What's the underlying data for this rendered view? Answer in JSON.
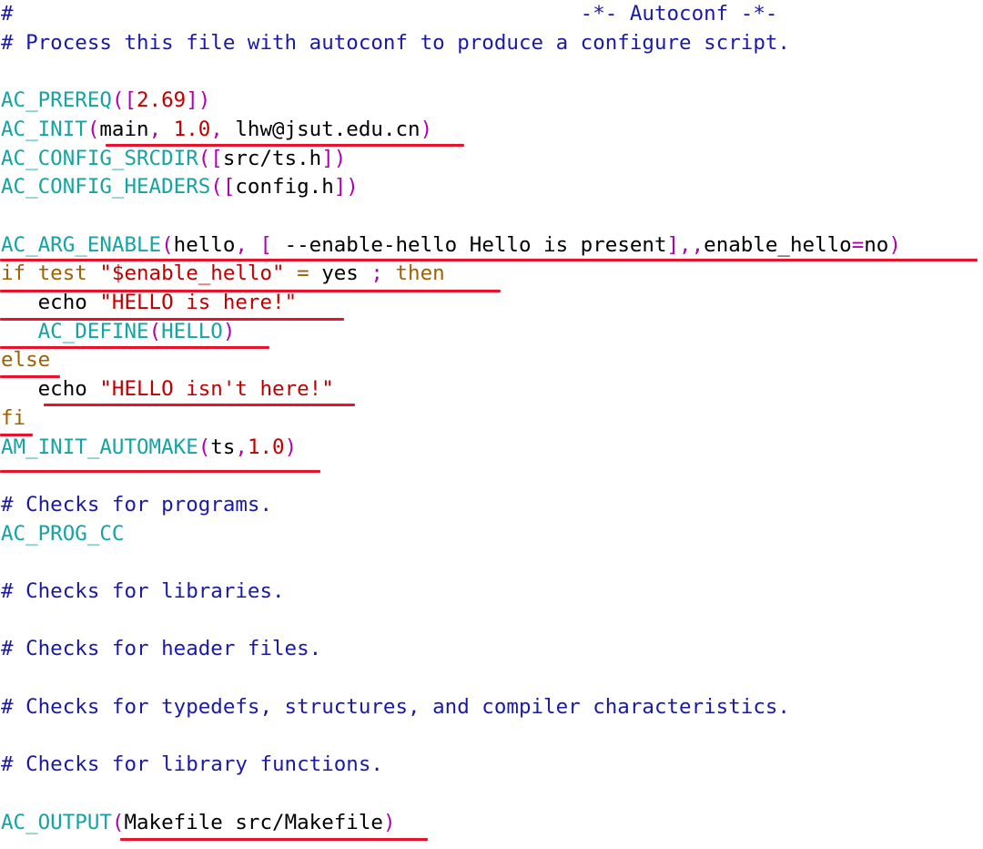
{
  "theme": {
    "comment": "#1a1aa6",
    "macro": "#16a3a3",
    "bracket": "#b000b0",
    "number_string": "#c00000",
    "keyword": "#a06000",
    "text": "#000000",
    "underline": "#e8132b"
  },
  "lines": [
    {
      "row": 0,
      "tokens": [
        {
          "t": "#",
          "c": "cm"
        },
        {
          "t": "                                              ",
          "c": "plain"
        },
        {
          "t": "-*- Autoconf -*-",
          "c": "cm"
        }
      ]
    },
    {
      "row": 1,
      "tokens": [
        {
          "t": "# Process this file with autoconf to produce a configure script.",
          "c": "cm"
        }
      ]
    },
    {
      "row": 3,
      "tokens": [
        {
          "t": "AC_PREREQ",
          "c": "mac"
        },
        {
          "t": "([",
          "c": "br"
        },
        {
          "t": "2.69",
          "c": "num"
        },
        {
          "t": "])",
          "c": "br"
        }
      ]
    },
    {
      "row": 4,
      "tokens": [
        {
          "t": "AC_INIT",
          "c": "mac"
        },
        {
          "t": "(",
          "c": "br"
        },
        {
          "t": "main",
          "c": "plain"
        },
        {
          "t": ", ",
          "c": "br"
        },
        {
          "t": "1.0",
          "c": "num"
        },
        {
          "t": ", ",
          "c": "br"
        },
        {
          "t": "lhw@jsut.edu.cn",
          "c": "plain"
        },
        {
          "t": ")",
          "c": "br"
        }
      ]
    },
    {
      "row": 5,
      "tokens": [
        {
          "t": "AC_CONFIG_SRCDIR",
          "c": "mac"
        },
        {
          "t": "([",
          "c": "br"
        },
        {
          "t": "src/ts.h",
          "c": "plain"
        },
        {
          "t": "])",
          "c": "br"
        }
      ]
    },
    {
      "row": 6,
      "tokens": [
        {
          "t": "AC_CONFIG_HEADERS",
          "c": "mac"
        },
        {
          "t": "([",
          "c": "br"
        },
        {
          "t": "config.h",
          "c": "plain"
        },
        {
          "t": "])",
          "c": "br"
        }
      ]
    },
    {
      "row": 8,
      "tokens": [
        {
          "t": "AC_ARG_ENABLE",
          "c": "mac"
        },
        {
          "t": "(",
          "c": "br"
        },
        {
          "t": "hello",
          "c": "plain"
        },
        {
          "t": ", [",
          "c": "br"
        },
        {
          "t": " --enable-hello Hello is present",
          "c": "plain"
        },
        {
          "t": "],,",
          "c": "br"
        },
        {
          "t": "enable_hello",
          "c": "plain"
        },
        {
          "t": "=",
          "c": "br"
        },
        {
          "t": "no",
          "c": "plain"
        },
        {
          "t": ")",
          "c": "br"
        }
      ]
    },
    {
      "row": 9,
      "tokens": [
        {
          "t": "if test ",
          "c": "kw"
        },
        {
          "t": "\"$enable_hello\"",
          "c": "str"
        },
        {
          "t": " = ",
          "c": "kw"
        },
        {
          "t": "yes",
          "c": "plain"
        },
        {
          "t": " ; ",
          "c": "br"
        },
        {
          "t": "then",
          "c": "kw"
        }
      ]
    },
    {
      "row": 10,
      "tokens": [
        {
          "t": "   echo ",
          "c": "plain"
        },
        {
          "t": "\"HELLO is here!\"",
          "c": "str"
        }
      ]
    },
    {
      "row": 11,
      "tokens": [
        {
          "t": "   AC_DEFINE",
          "c": "mac"
        },
        {
          "t": "(",
          "c": "br"
        },
        {
          "t": "HELLO",
          "c": "mac"
        },
        {
          "t": ")",
          "c": "br"
        }
      ]
    },
    {
      "row": 12,
      "tokens": [
        {
          "t": "else",
          "c": "kw"
        }
      ]
    },
    {
      "row": 13,
      "tokens": [
        {
          "t": "   echo ",
          "c": "plain"
        },
        {
          "t": "\"HELLO isn't here!\"",
          "c": "str"
        }
      ]
    },
    {
      "row": 14,
      "tokens": [
        {
          "t": "fi",
          "c": "kw"
        }
      ]
    },
    {
      "row": 15,
      "tokens": [
        {
          "t": "AM_INIT_AUTOMAKE",
          "c": "mac"
        },
        {
          "t": "(",
          "c": "br"
        },
        {
          "t": "ts",
          "c": "plain"
        },
        {
          "t": ",",
          "c": "br"
        },
        {
          "t": "1.0",
          "c": "num"
        },
        {
          "t": ")",
          "c": "br"
        }
      ]
    },
    {
      "row": 17,
      "tokens": [
        {
          "t": "# Checks for programs.",
          "c": "cm"
        }
      ]
    },
    {
      "row": 18,
      "tokens": [
        {
          "t": "AC_PROG_CC",
          "c": "mac"
        }
      ]
    },
    {
      "row": 20,
      "tokens": [
        {
          "t": "# Checks for libraries.",
          "c": "cm"
        }
      ]
    },
    {
      "row": 22,
      "tokens": [
        {
          "t": "# Checks for header files.",
          "c": "cm"
        }
      ]
    },
    {
      "row": 24,
      "tokens": [
        {
          "t": "# Checks for typedefs, structures, and compiler characteristics.",
          "c": "cm"
        }
      ]
    },
    {
      "row": 26,
      "tokens": [
        {
          "t": "# Checks for library functions.",
          "c": "cm"
        }
      ]
    },
    {
      "row": 28,
      "tokens": [
        {
          "t": "AC_OUTPUT",
          "c": "mac"
        },
        {
          "t": "(",
          "c": "br"
        },
        {
          "t": "Makefile src/Makefile",
          "c": "plain"
        },
        {
          "t": ")",
          "c": "br"
        }
      ]
    }
  ]
}
